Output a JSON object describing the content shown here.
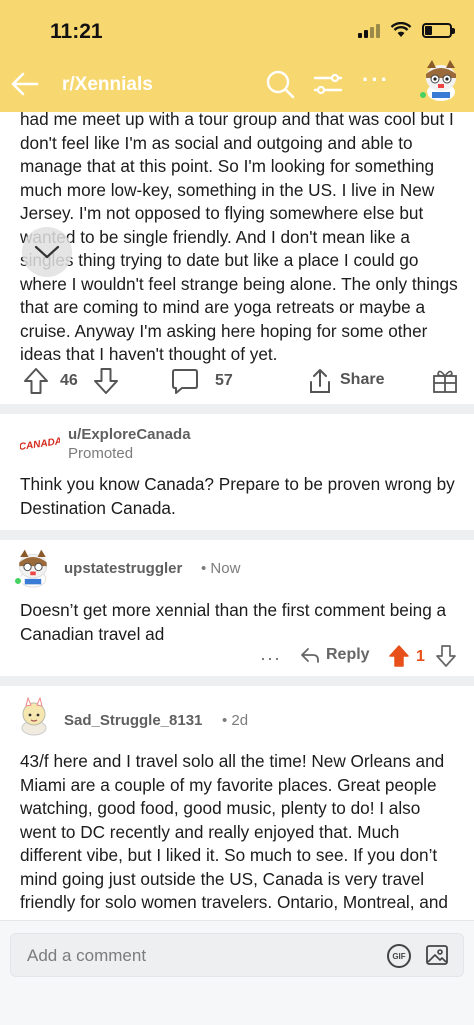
{
  "status_bar": {
    "time": "11:21"
  },
  "nav": {
    "subreddit": "r/Xennials"
  },
  "post": {
    "body": "had me meet up with a tour group and that was cool but I don't feel like I'm as social and outgoing and able to manage that at this point. So I'm looking for something much more low-key, something in the US. I live in New Jersey. I'm not opposed to flying somewhere else but wanted to be single friendly. And I don't mean like a singles thing trying to date but like a place I could go where I wouldn't feel strange being alone. The only things that are coming to mind are yoga retreats or maybe a cruise. Anyway I'm asking here hoping for some other ideas that I haven't thought of yet.",
    "votes": "46",
    "comments": "57",
    "share_label": "Share"
  },
  "promoted": {
    "author": "u/ExploreCanada",
    "label": "Promoted",
    "logo_text": "CANADA",
    "text": "Think you know Canada? Prepare to be proven wrong by Destination Canada."
  },
  "comments": [
    {
      "author": "upstatestruggler",
      "meta": "• Now",
      "text": "Doesn’t get more xennial than the first comment being a Canadian travel ad",
      "reply_label": "Reply",
      "votes": "1"
    },
    {
      "author": "Sad_Struggle_8131",
      "meta": "• 2d",
      "text": "43/f here and I travel solo all the time! New Orleans and Miami are a couple of my favorite places. Great people watching, good food, good music, plenty to do! I also went to DC recently and really enjoyed that. Much different vibe, but I liked it. So much to see. If you don’t mind going just outside the US, Canada is very travel friendly for solo women travelers. Ontario, Montreal, and"
    }
  ],
  "composer": {
    "placeholder": "Add a comment",
    "gif_label": "GIF"
  },
  "colors": {
    "header": "#f7d870",
    "upvote_active": "#e8501b",
    "divider": "#edeff1"
  }
}
